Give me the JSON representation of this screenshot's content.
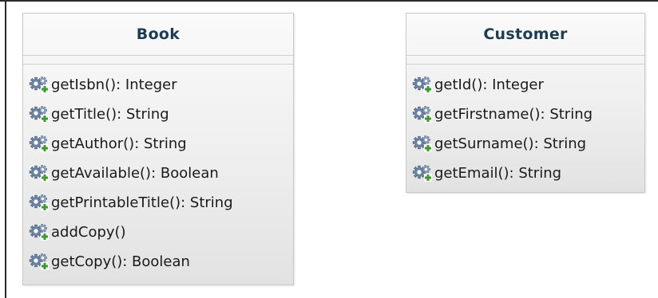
{
  "classes": [
    {
      "name": "Book",
      "operations": [
        "getIsbn(): Integer",
        "getTitle(): String",
        "getAuthor(): String",
        "getAvailable(): Boolean",
        "getPrintableTitle(): String",
        "addCopy()",
        "getCopy(): Boolean"
      ]
    },
    {
      "name": "Customer",
      "operations": [
        "getId(): Integer",
        "getFirstname(): String",
        "getSurname(): String",
        "getEmail(): String"
      ]
    }
  ],
  "icons": {
    "operation": "gears-plus-icon"
  },
  "colors": {
    "class_title": "#1f3d52",
    "class_border": "#c9c9c9",
    "class_fill_top": "#fafafa",
    "class_fill_bottom": "#e2e2e2",
    "gear": "#6e86a6",
    "plus": "#3f9a2e"
  }
}
